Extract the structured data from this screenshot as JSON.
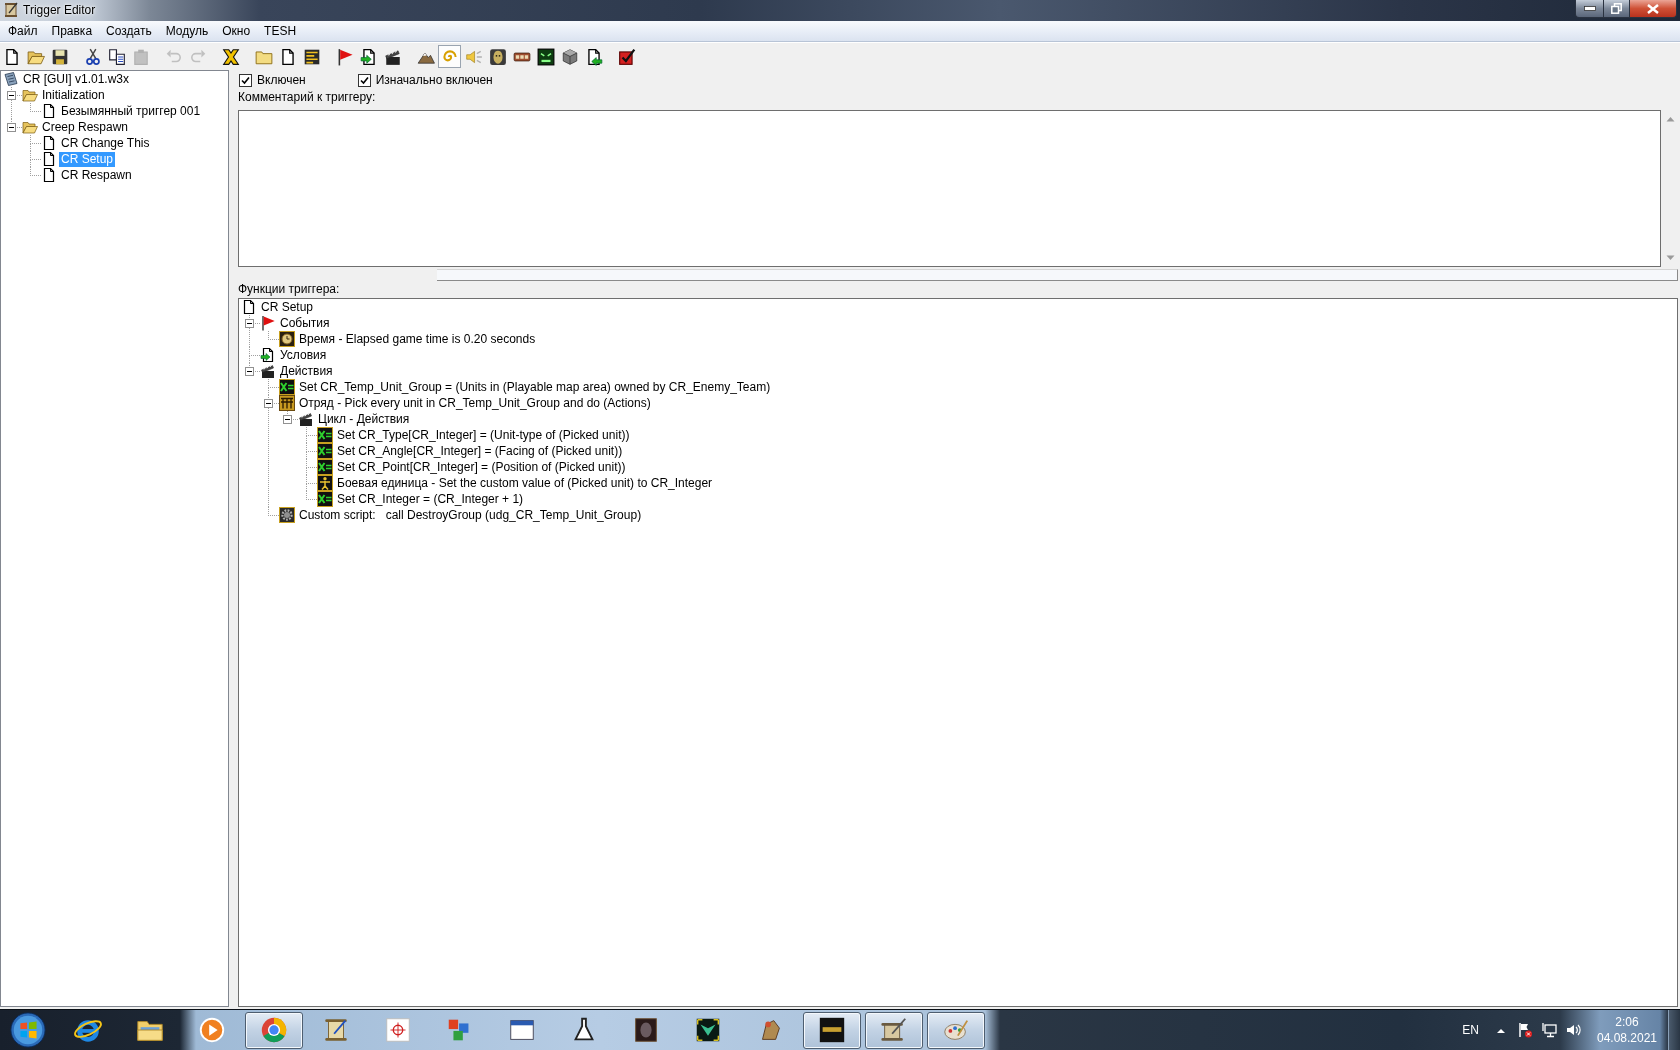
{
  "window": {
    "title": "Trigger Editor"
  },
  "menu": [
    "Файл",
    "Правка",
    "Создать",
    "Модуль",
    "Окно",
    "TESH"
  ],
  "toolbar": [
    [
      {
        "disabled": false,
        "pressed": false
      },
      {
        "disabled": false,
        "pressed": false
      },
      {
        "disabled": false,
        "pressed": false
      }
    ],
    [
      {
        "disabled": false,
        "pressed": false
      },
      {
        "disabled": false,
        "pressed": false
      },
      {
        "disabled": true,
        "pressed": false
      }
    ],
    [
      {
        "disabled": true,
        "pressed": false
      },
      {
        "disabled": true,
        "pressed": false
      }
    ],
    [
      {
        "disabled": false,
        "pressed": false
      }
    ],
    [
      {
        "disabled": false,
        "pressed": false
      },
      {
        "disabled": false,
        "pressed": false
      },
      {
        "disabled": false,
        "pressed": false
      }
    ],
    [
      {
        "disabled": false,
        "pressed": false
      },
      {
        "disabled": false,
        "pressed": false
      },
      {
        "disabled": false,
        "pressed": false
      }
    ],
    [
      {
        "disabled": false,
        "pressed": false
      },
      {
        "disabled": false,
        "pressed": true
      },
      {
        "disabled": false,
        "pressed": false
      },
      {
        "disabled": false,
        "pressed": false
      },
      {
        "disabled": false,
        "pressed": false
      },
      {
        "disabled": false,
        "pressed": false
      },
      {
        "disabled": false,
        "pressed": false
      },
      {
        "disabled": false,
        "pressed": false
      }
    ],
    [
      {
        "disabled": false,
        "pressed": false
      }
    ]
  ],
  "map_tree": {
    "label": "CR [GUI] v1.01.w3x",
    "kind": "map",
    "selected": false,
    "children": [
      {
        "label": "Initialization",
        "kind": "category",
        "selected": false,
        "expanded": true,
        "children": [
          {
            "label": "Безымянный триггер 001",
            "kind": "trigger",
            "selected": false
          }
        ]
      },
      {
        "label": "Creep Respawn",
        "kind": "category",
        "selected": false,
        "expanded": true,
        "children": [
          {
            "label": "CR Change This",
            "kind": "trigger",
            "selected": false
          },
          {
            "label": "CR Setup",
            "kind": "trigger",
            "selected": true
          },
          {
            "label": "CR Respawn",
            "kind": "trigger",
            "selected": false
          }
        ]
      }
    ]
  },
  "options": [
    {
      "label": "Включен",
      "checked": true
    },
    {
      "label": "Изначально включен",
      "checked": true
    }
  ],
  "comment": {
    "label": "Комментарий к триггеру:"
  },
  "functions": {
    "label": "Функции триггера:",
    "tree": {
      "label": "CR Setup",
      "kind": "trigger",
      "selected": false,
      "children": [
        {
          "label": "События",
          "kind": "events",
          "selected": false,
          "expanded": true,
          "children": [
            {
              "label": "Время - Elapsed game time is 0.20 seconds",
              "kind": "event",
              "selected": false
            }
          ]
        },
        {
          "label": "Условия",
          "kind": "conditions",
          "selected": false
        },
        {
          "label": "Действия",
          "kind": "actions",
          "selected": false,
          "expanded": true,
          "children": [
            {
              "label": "Set CR_Temp_Unit_Group = (Units in (Playable map area) owned by CR_Enemy_Team)",
              "kind": "set",
              "selected": false
            },
            {
              "label": "Отряд - Pick every unit in CR_Temp_Unit_Group and do (Actions)",
              "kind": "group",
              "selected": false,
              "expanded": true,
              "children": [
                {
                  "label": "Цикл - Действия",
                  "kind": "loop",
                  "selected": false,
                  "expanded": true,
                  "children": [
                    {
                      "label": "Set CR_Type[CR_Integer] = (Unit-type of (Picked unit))",
                      "kind": "set",
                      "selected": false
                    },
                    {
                      "label": "Set CR_Angle[CR_Integer] = (Facing of (Picked unit))",
                      "kind": "set",
                      "selected": false
                    },
                    {
                      "label": "Set CR_Point[CR_Integer] = (Position of (Picked unit))",
                      "kind": "set",
                      "selected": false
                    },
                    {
                      "label": "Боевая единица - Set the custom value of (Picked unit) to CR_Integer",
                      "kind": "unit",
                      "selected": false
                    },
                    {
                      "label": "Set CR_Integer = (CR_Integer + 1)",
                      "kind": "set",
                      "selected": false
                    }
                  ]
                }
              ]
            },
            {
              "label": "Custom script:   call DestroyGroup (udg_CR_Temp_Unit_Group)",
              "kind": "script",
              "selected": false
            }
          ]
        }
      ]
    }
  },
  "taskbar": {
    "apps": [
      {
        "running": false
      },
      {
        "running": false
      },
      {
        "running": false
      },
      {
        "running": true
      },
      {
        "running": false
      },
      {
        "running": false
      },
      {
        "running": false
      },
      {
        "running": false
      },
      {
        "running": false
      },
      {
        "running": false
      },
      {
        "running": false
      },
      {
        "running": false
      },
      {
        "running": true
      },
      {
        "running": true
      },
      {
        "running": true
      }
    ],
    "tray": {
      "language": "EN",
      "time": "2:06",
      "date": "04.08.2021"
    }
  }
}
